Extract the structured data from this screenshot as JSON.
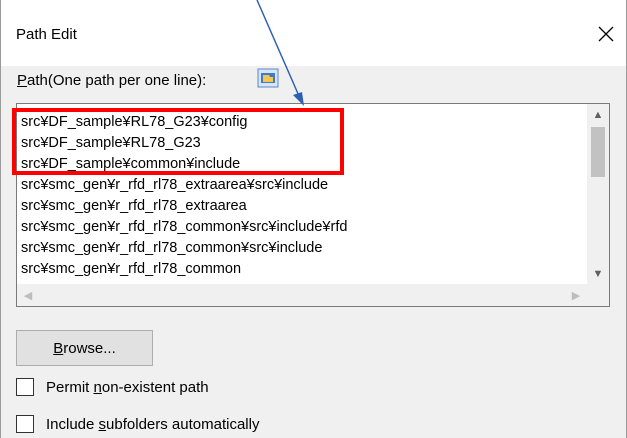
{
  "dialog": {
    "title": "Path Edit"
  },
  "path": {
    "label_first": "P",
    "label_rest": "ath(One path per one line):",
    "lines": [
      "src¥DF_sample¥RL78_G23¥config",
      "src¥DF_sample¥RL78_G23",
      "src¥DF_sample¥common¥include",
      "src¥smc_gen¥r_rfd_rl78_extraarea¥src¥include",
      "src¥smc_gen¥r_rfd_rl78_extraarea",
      "src¥smc_gen¥r_rfd_rl78_common¥src¥include¥rfd",
      "src¥smc_gen¥r_rfd_rl78_common¥src¥include",
      "src¥smc_gen¥r_rfd_rl78_common"
    ]
  },
  "browse": {
    "label_first": "B",
    "label_rest": "rowse..."
  },
  "options": {
    "permit_pre": "Permit ",
    "permit_ul": "n",
    "permit_post": "on-existent path",
    "include_pre": "Include ",
    "include_ul": "s",
    "include_post": "ubfolders automatically"
  },
  "annotation": {
    "highlight_color": "#ff0000",
    "arrow_color": "#2e5fb4"
  },
  "icons": [
    "close-icon",
    "folder-browse-icon",
    "scroll-up-icon",
    "scroll-down-icon",
    "scroll-left-icon",
    "scroll-right-icon"
  ]
}
